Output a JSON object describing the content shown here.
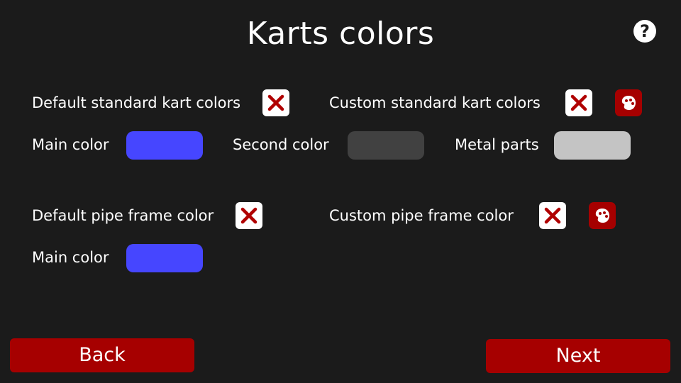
{
  "screen": {
    "title": "Karts colors",
    "help_label": "?"
  },
  "standard_kart": {
    "default_label": "Default standard kart colors",
    "default_checked": false,
    "custom_label": "Custom standard kart colors",
    "custom_checked": false,
    "main_color_label": "Main color",
    "main_color": "#4646ff",
    "second_color_label": "Second color",
    "second_color": "#414141",
    "metal_parts_label": "Metal parts",
    "metal_parts_color": "#c4c4c4"
  },
  "pipe_frame": {
    "default_label": "Default pipe frame color",
    "default_checked": false,
    "custom_label": "Custom pipe frame color",
    "custom_checked": false,
    "main_color_label": "Main color",
    "main_color": "#4646ff"
  },
  "navigation": {
    "back_label": "Back",
    "next_label": "Next"
  },
  "colors": {
    "background": "#1b1b1b",
    "accent_red": "#a60000",
    "checkbox_x": "#b00000"
  },
  "icons": {
    "unchecked": "x-mark-icon",
    "paint": "paint-palette-icon",
    "help": "help-icon"
  }
}
